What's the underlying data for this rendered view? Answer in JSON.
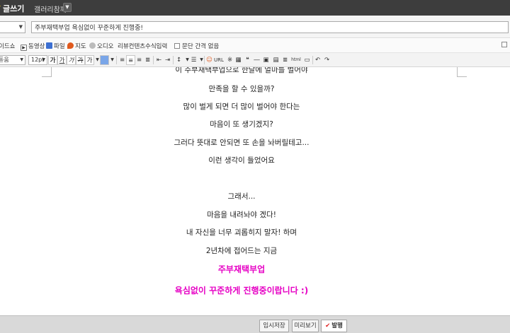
{
  "topbar": {
    "write_label": "글쓰기",
    "gallery_label": "갤러리참께",
    "dropdown_glyph": "▼"
  },
  "title_row": {
    "category_value": "",
    "title_value": "주부재택부업 욕심없이 꾸준하게 진행중!"
  },
  "attach_toolbar": {
    "slideshow": "이드쇼",
    "video": "동영상",
    "file": "파일",
    "map": "지도",
    "audio": "오디오",
    "review": "리뷰컨텐츠",
    "formula": "수식입력",
    "paragraph_spacing": "문단 간격 없음"
  },
  "format_toolbar": {
    "font_family": "돋움",
    "font_size": "12pt",
    "bold": "가",
    "underline": "가",
    "italic": "가",
    "strike": "가",
    "url": "URL"
  },
  "editor": {
    "lines": [
      "이 주부재택부업으로 한달에 얼마를 벌어야",
      "만족을 할 수 있을까?",
      "많이 벌게 되면 더 많이 벌어야 한다는",
      "마음이 또 생기겠지?",
      "그러다 뜻대로 안되면 또 손을 놔버릴테고...",
      "이런 생각이 들었어요",
      "그래서...",
      "마음을 내려놔야 겠다!",
      "내 자신을 너무 괴롭히지 말자! 하며",
      "2년차에 접어드는 지금",
      "주부재택부업",
      "욕심없이 꾸준하게 진행중이랍니다 :)"
    ],
    "highlight_color": "#e600c4"
  },
  "bottom_bar": {
    "save_draft": "임시저장",
    "preview": "미리보기",
    "publish": "발행",
    "publish_check": "✔"
  }
}
